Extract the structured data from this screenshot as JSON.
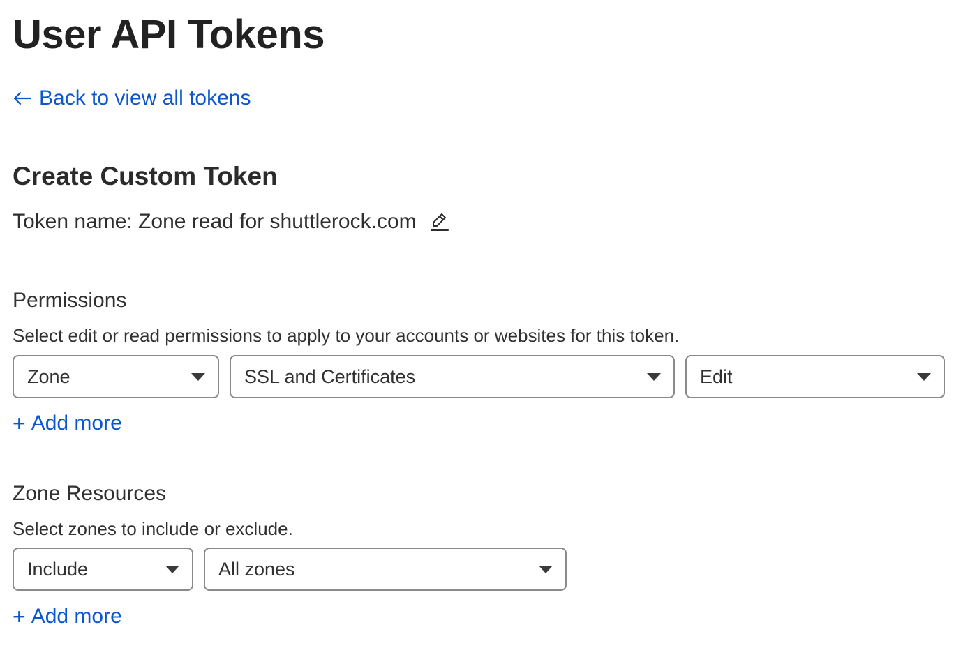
{
  "header": {
    "title": "User API Tokens",
    "back_link": "Back to view all tokens"
  },
  "form": {
    "title": "Create Custom Token",
    "token_name": "Token name: Zone read for shuttlerock.com",
    "icons": {
      "back": "arrow-left-icon",
      "edit": "pencil-icon",
      "add": "plus-icon",
      "dropdown": "caret-down-icon"
    },
    "permissions": {
      "label": "Permissions",
      "description": "Select edit or read permissions to apply to your accounts or websites for this token.",
      "scope": "Zone",
      "permission": "SSL and Certificates",
      "access": "Edit",
      "add_more": "Add more"
    },
    "zone_resources": {
      "label": "Zone Resources",
      "description": "Select zones to include or exclude.",
      "operator": "Include",
      "target": "All zones",
      "add_more": "Add more"
    }
  },
  "colors": {
    "link": "#0b57d0",
    "text": "#313131",
    "border": "#8a8a8a"
  }
}
